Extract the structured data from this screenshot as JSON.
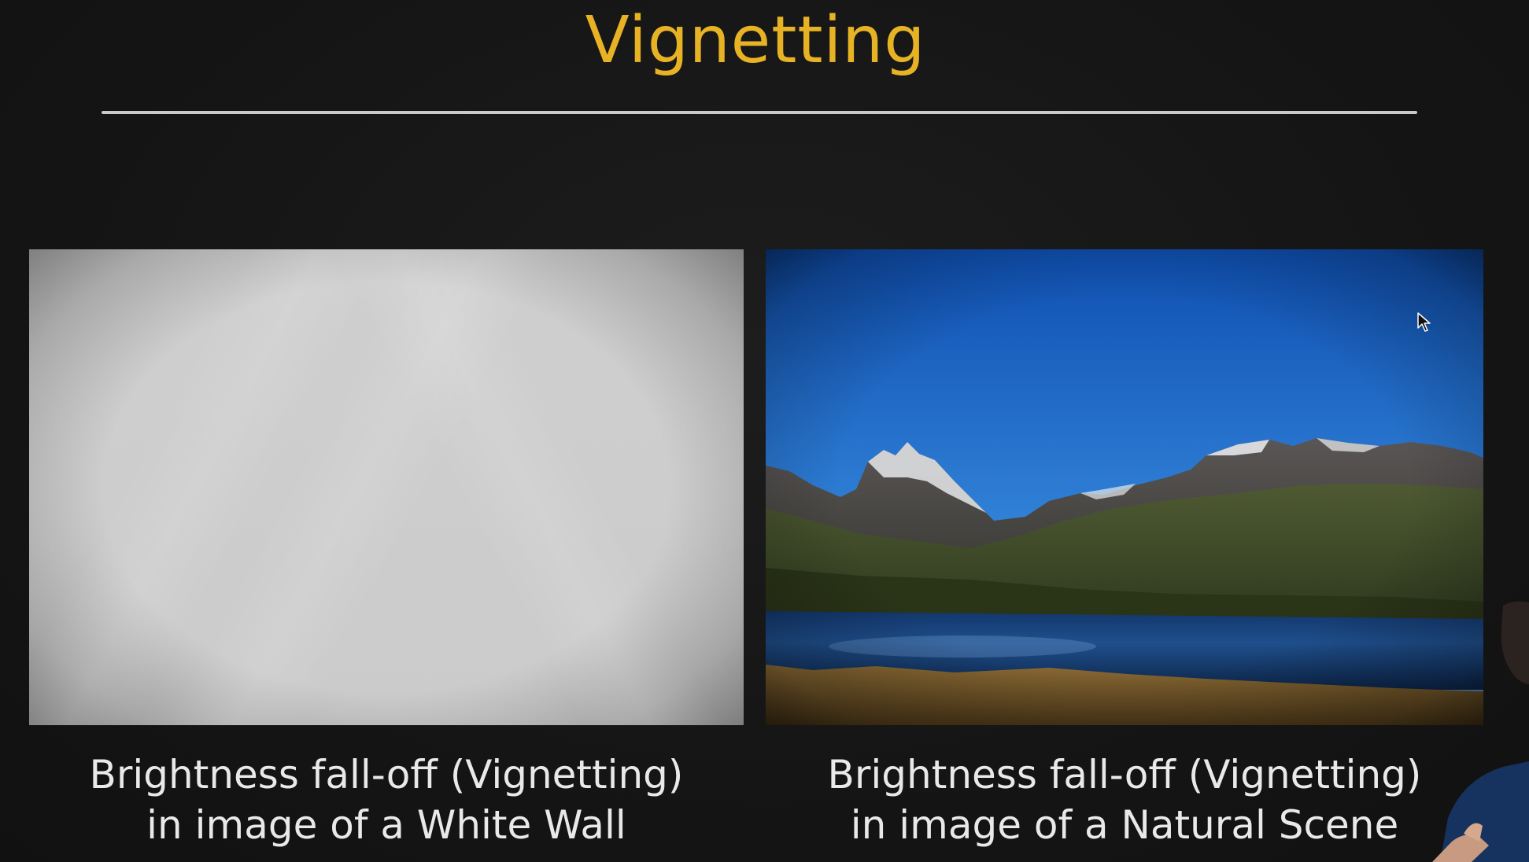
{
  "slide": {
    "title": "Vignetting",
    "title_color": "#e7b325",
    "left_panel": {
      "caption_line1": "Brightness fall-off (Vignetting)",
      "caption_line2": "in image of a White Wall"
    },
    "right_panel": {
      "caption_line1": "Brightness fall-off (Vignetting)",
      "caption_line2": "in image of a Natural Scene"
    }
  },
  "overlays": {
    "cursor_icon": "mouse-pointer-icon",
    "presenter": "presenter-video-overlay"
  }
}
